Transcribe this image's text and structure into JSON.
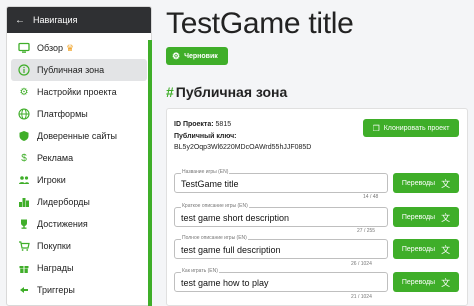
{
  "sidebar": {
    "header": "Навигация",
    "items": [
      {
        "label": "Обзор",
        "icon": "monitor-icon"
      },
      {
        "label": "Публичная зона",
        "icon": "info-icon"
      },
      {
        "label": "Настройки проекта",
        "icon": "gear-icon"
      },
      {
        "label": "Платформы",
        "icon": "globe-icon"
      },
      {
        "label": "Доверенные сайты",
        "icon": "shield-icon"
      },
      {
        "label": "Реклама",
        "icon": "dollar-icon"
      },
      {
        "label": "Игроки",
        "icon": "players-icon"
      },
      {
        "label": "Лидерборды",
        "icon": "leaderboard-icon"
      },
      {
        "label": "Достижения",
        "icon": "trophy-icon"
      },
      {
        "label": "Покупки",
        "icon": "cart-icon"
      },
      {
        "label": "Награды",
        "icon": "gift-icon"
      },
      {
        "label": "Триггеры",
        "icon": "trigger-icon"
      }
    ]
  },
  "page": {
    "title": "TestGame title",
    "draft_label": "Черновик",
    "section_title": "Публичная зона",
    "section_hash": "#"
  },
  "card": {
    "id_label": "ID Проекта:",
    "id_value": "5815",
    "key_label": "Публичный ключ:",
    "key_value": "BL5y2Oqp3Wl6220MDcOAWrd55hJJF085D",
    "clone_label": "Клонировать проект",
    "translations_label": "Переводы",
    "fields": [
      {
        "label": "Название игры (EN)",
        "value": "TestGame title",
        "counter": "14 / 48"
      },
      {
        "label": "Краткое описание игры (EN)",
        "value": "test game short description",
        "counter": "27 / 255"
      },
      {
        "label": "Полное описание игры (EN)",
        "value": "test game full description",
        "counter": "26 / 1024"
      },
      {
        "label": "Как играть (EN)",
        "value": "test game how to play",
        "counter": "21 / 1024"
      }
    ]
  },
  "colors": {
    "accent": "#3fae29",
    "header_bg": "#2f3033"
  }
}
